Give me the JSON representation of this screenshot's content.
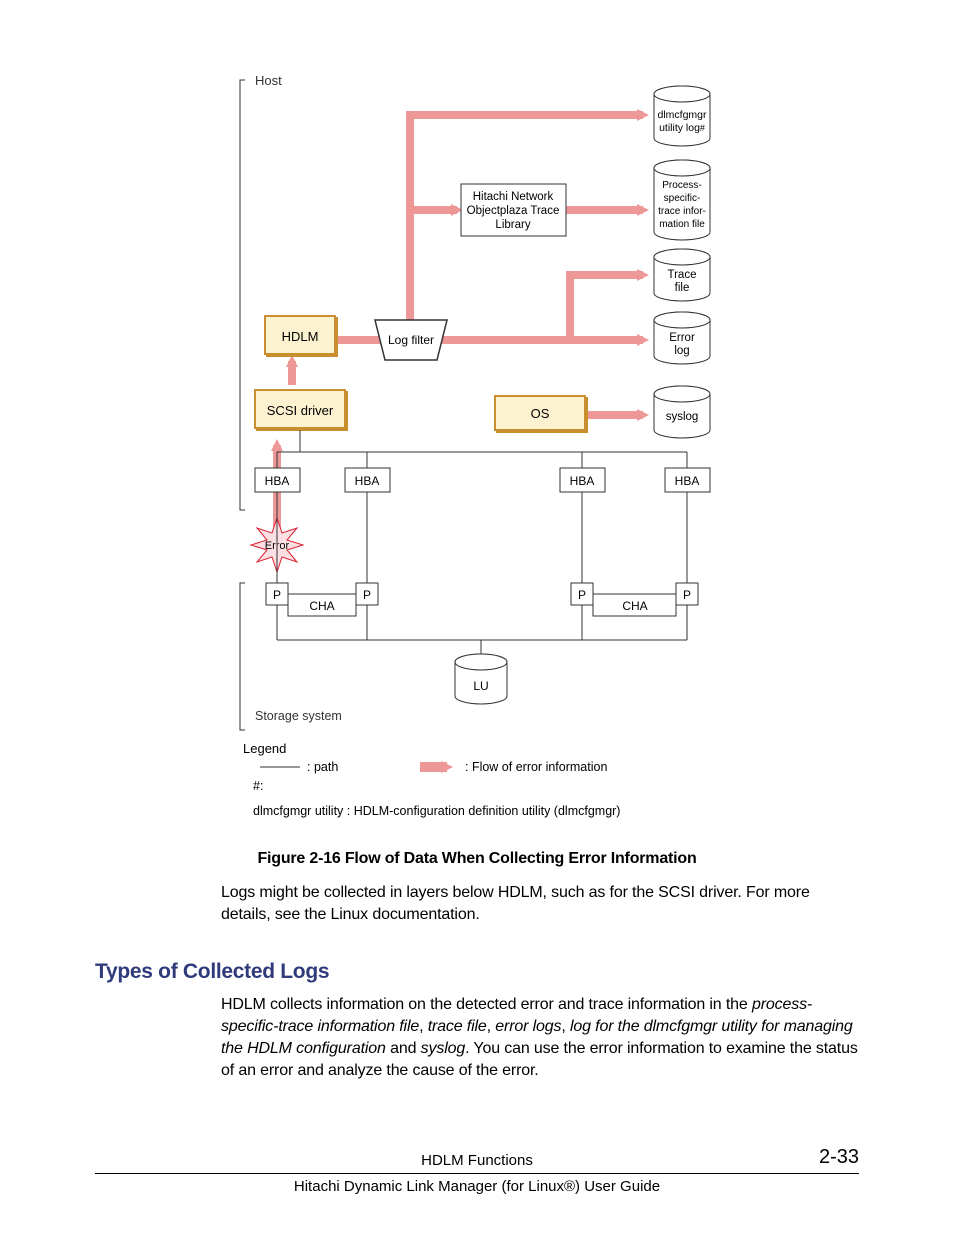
{
  "diagram": {
    "host_label": "Host",
    "storage_label": "Storage system",
    "hdlm": "HDLM",
    "scsi": "SCSI driver",
    "log_filter": "Log filter",
    "os": "OS",
    "hba": "HBA",
    "net_lib_l1": "Hitachi Network",
    "net_lib_l2": "Objectplaza Trace",
    "net_lib_l3": "Library",
    "cyl_util1": "dlmcfgmgr",
    "cyl_util2": "utility log",
    "cyl_proc1": "Process-",
    "cyl_proc2": "specific-",
    "cyl_proc3": "trace infor-",
    "cyl_proc4": "mation file",
    "cyl_trace1": "Trace",
    "cyl_trace2": "file",
    "cyl_err1": "Error",
    "cyl_err2": "log",
    "cyl_syslog": "syslog",
    "error": "Error",
    "p": "P",
    "cha": "CHA",
    "lu": "LU",
    "hash": "#",
    "legend_title": "Legend",
    "legend_path": ": path",
    "legend_flow": ": Flow of error information",
    "footnote": "dlmcfgmgr utility : HDLM-configuration definition utility (dlmcfgmgr)",
    "hash_mark": "#:"
  },
  "caption": "Figure 2-16 Flow of Data When Collecting Error Information",
  "para1": "Logs might be collected in layers below HDLM, such as for the SCSI driver. For more details, see the Linux documentation.",
  "heading": "Types of Collected Logs",
  "para2_a": "HDLM collects information on the detected error and trace information in the ",
  "para2_b": "process-specific-trace information file",
  "para2_c": ", ",
  "para2_d": "trace file",
  "para2_e": ", ",
  "para2_f": "error logs",
  "para2_g": ", ",
  "para2_h": "log for the dlmcfgmgr utility for managing the HDLM configuration",
  "para2_i": " and ",
  "para2_j": "syslog",
  "para2_k": ". You can use the error information to examine the status of an error and analyze the cause of the error.",
  "footer_top": "HDLM Functions",
  "page_num": "2-33",
  "footer_bottom": "Hitachi Dynamic Link Manager (for Linux®) User Guide"
}
